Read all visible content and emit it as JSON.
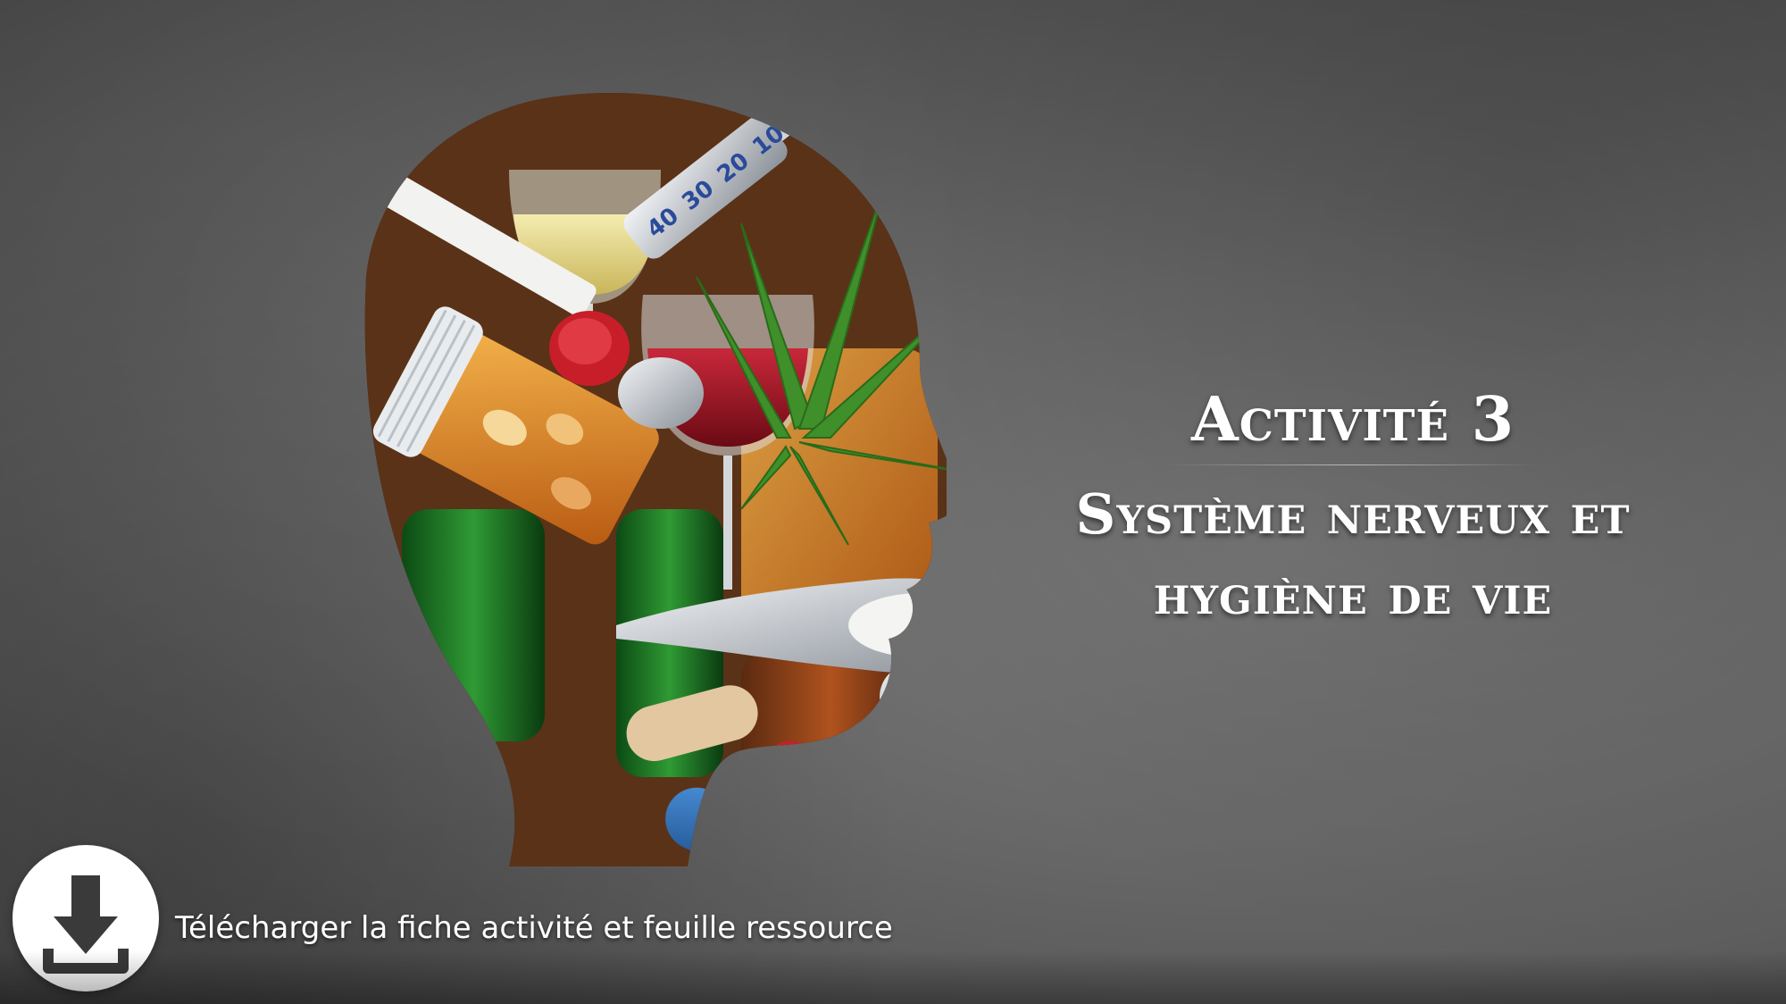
{
  "slide": {
    "title_line1": "Activité 3",
    "title_line2": "Système nerveux et",
    "title_line3": "hygiène de vie"
  },
  "download": {
    "icon": "download-icon",
    "label": "Télécharger la fiche activité et feuille ressource"
  },
  "illustration": {
    "subject": "head-silhouette-of-drugs-illustration"
  },
  "colors": {
    "background": "#5e5e5e",
    "title_text": "#ffffff",
    "button_bg": "#ffffff",
    "icon": "#3a3a3a"
  }
}
